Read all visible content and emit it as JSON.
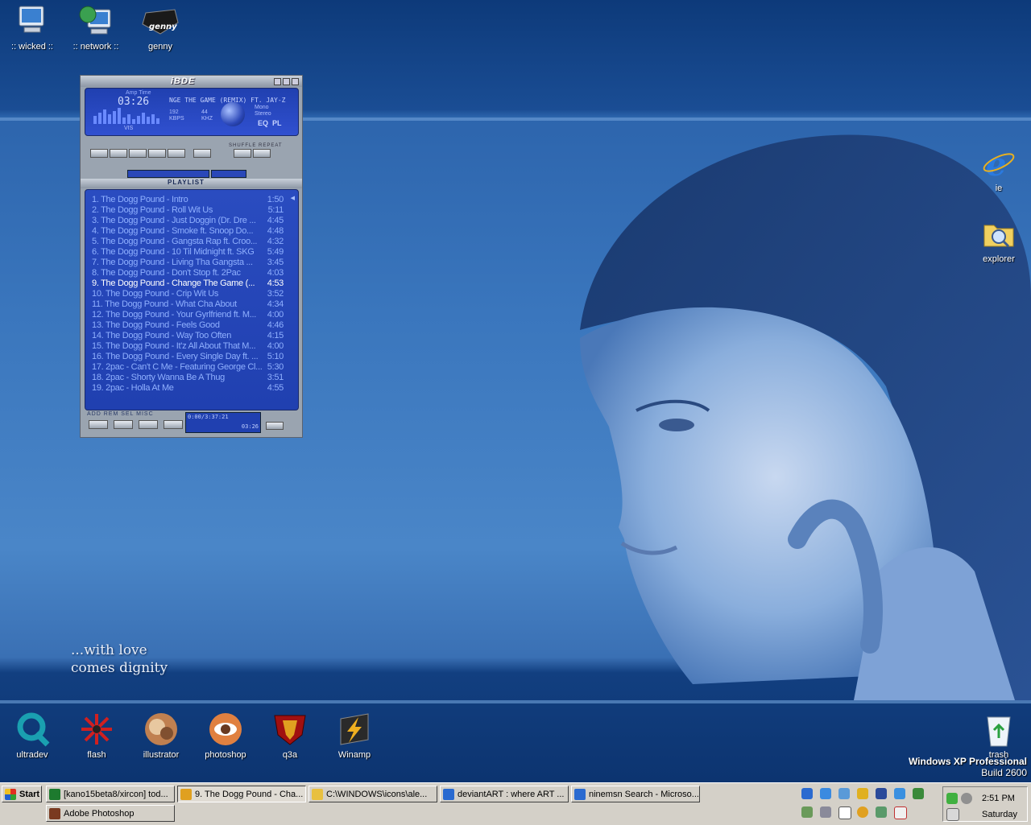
{
  "desktop": {
    "icons_top": [
      {
        "label": ":: wicked ::",
        "icon": "computer-icon"
      },
      {
        "label": ":: network ::",
        "icon": "network-icon"
      },
      {
        "label": "genny",
        "icon": "genny-icon"
      }
    ],
    "icons_right": [
      {
        "label": "ie",
        "icon": "internet-explorer-icon"
      },
      {
        "label": "explorer",
        "icon": "folder-search-icon"
      }
    ],
    "icons_bottom": [
      {
        "label": "ultradev",
        "icon": "ultradev-icon"
      },
      {
        "label": "flash",
        "icon": "flash-icon"
      },
      {
        "label": "illustrator",
        "icon": "illustrator-icon"
      },
      {
        "label": "photoshop",
        "icon": "photoshop-icon"
      },
      {
        "label": "q3a",
        "icon": "quake-icon"
      },
      {
        "label": "Winamp",
        "icon": "winamp-icon"
      }
    ],
    "trash": {
      "label": "trash",
      "icon": "recycle-bin-icon"
    },
    "tagline": [
      "...with love",
      "comes dignity"
    ],
    "os_name": "Windows XP Professional",
    "os_build": "Build 2600"
  },
  "winamp": {
    "logo": "iBDE",
    "amp_label": "Amp Time",
    "time": "03:26",
    "ticker": "NGE THE GAME (REMIX) FT. JAY-Z",
    "kbps_value": "192",
    "kbps_label": "KBPS",
    "khz_value": "44",
    "khz_label": "KHZ",
    "mono": "Mono",
    "stereo": "Stereo",
    "eq": "EQ",
    "pl": "PL",
    "vis": "VIS",
    "shuffle": "SHUFFLE REPEAT",
    "playlist_title": "PLAYLIST",
    "footer": "ADD REM SEL MISC",
    "pl_time": "0:00/3:37:21",
    "pl_current": "03:26",
    "current_index": 8,
    "tracks": [
      {
        "title": "1. The Dogg Pound - Intro",
        "dur": "1:50"
      },
      {
        "title": "2. The Dogg Pound - Roll Wit Us",
        "dur": "5:11"
      },
      {
        "title": "3. The Dogg Pound - Just Doggin (Dr. Dre ...",
        "dur": "4:45"
      },
      {
        "title": "4. The Dogg Pound -  Smoke ft. Snoop Do...",
        "dur": "4:48"
      },
      {
        "title": "5. The Dogg Pound - Gangsta Rap ft. Croo...",
        "dur": "4:32"
      },
      {
        "title": "6. The Dogg Pound - 10 Til Midnight ft. SKG",
        "dur": "5:49"
      },
      {
        "title": "7. The Dogg Pound - Living Tha Gangsta ...",
        "dur": "3:45"
      },
      {
        "title": "8. The Dogg Pound - Don't Stop ft. 2Pac",
        "dur": "4:03"
      },
      {
        "title": "9. The Dogg Pound - Change The Game (...",
        "dur": "4:53"
      },
      {
        "title": "10. The Dogg Pound - Crip Wit Us",
        "dur": "3:52"
      },
      {
        "title": "11. The Dogg Pound - What Cha About",
        "dur": "4:34"
      },
      {
        "title": "12. The Dogg Pound - Your Gyrlfriend ft. M...",
        "dur": "4:00"
      },
      {
        "title": "13. The Dogg Pound - Feels Good",
        "dur": "4:46"
      },
      {
        "title": "14. The Dogg Pound - Way Too Often",
        "dur": "4:15"
      },
      {
        "title": "15. The Dogg Pound - It'z All About That M...",
        "dur": "4:00"
      },
      {
        "title": "16. The Dogg Pound - Every Single Day ft. ...",
        "dur": "5:10"
      },
      {
        "title": "17. 2pac - Can't C Me - Featuring George Cl...",
        "dur": "5:30"
      },
      {
        "title": "18. 2pac - Shorty Wanna Be A Thug",
        "dur": "3:51"
      },
      {
        "title": "19. 2pac - Holla At Me",
        "dur": "4:55"
      }
    ]
  },
  "taskbar": {
    "start": "Start",
    "tasks": [
      {
        "label": "[kano15beta8/xircon] tod...",
        "icon": "excel-icon",
        "color": "#1d7a2e"
      },
      {
        "label": "9. The Dogg Pound - Cha...",
        "icon": "winamp-icon",
        "color": "#e0a020"
      },
      {
        "label": "C:\\WINDOWS\\icons\\ale...",
        "icon": "folder-icon",
        "color": "#e8c040"
      },
      {
        "label": "deviantART : where ART ...",
        "icon": "internet-explorer-icon",
        "color": "#2a6ad0"
      },
      {
        "label": "ninemsn Search - Microso...",
        "icon": "internet-explorer-icon",
        "color": "#2a6ad0"
      },
      {
        "label": "Adobe Photoshop",
        "icon": "photoshop-icon",
        "color": "#7a3a20"
      }
    ],
    "clock": "2:51 PM",
    "day": "Saturday"
  }
}
